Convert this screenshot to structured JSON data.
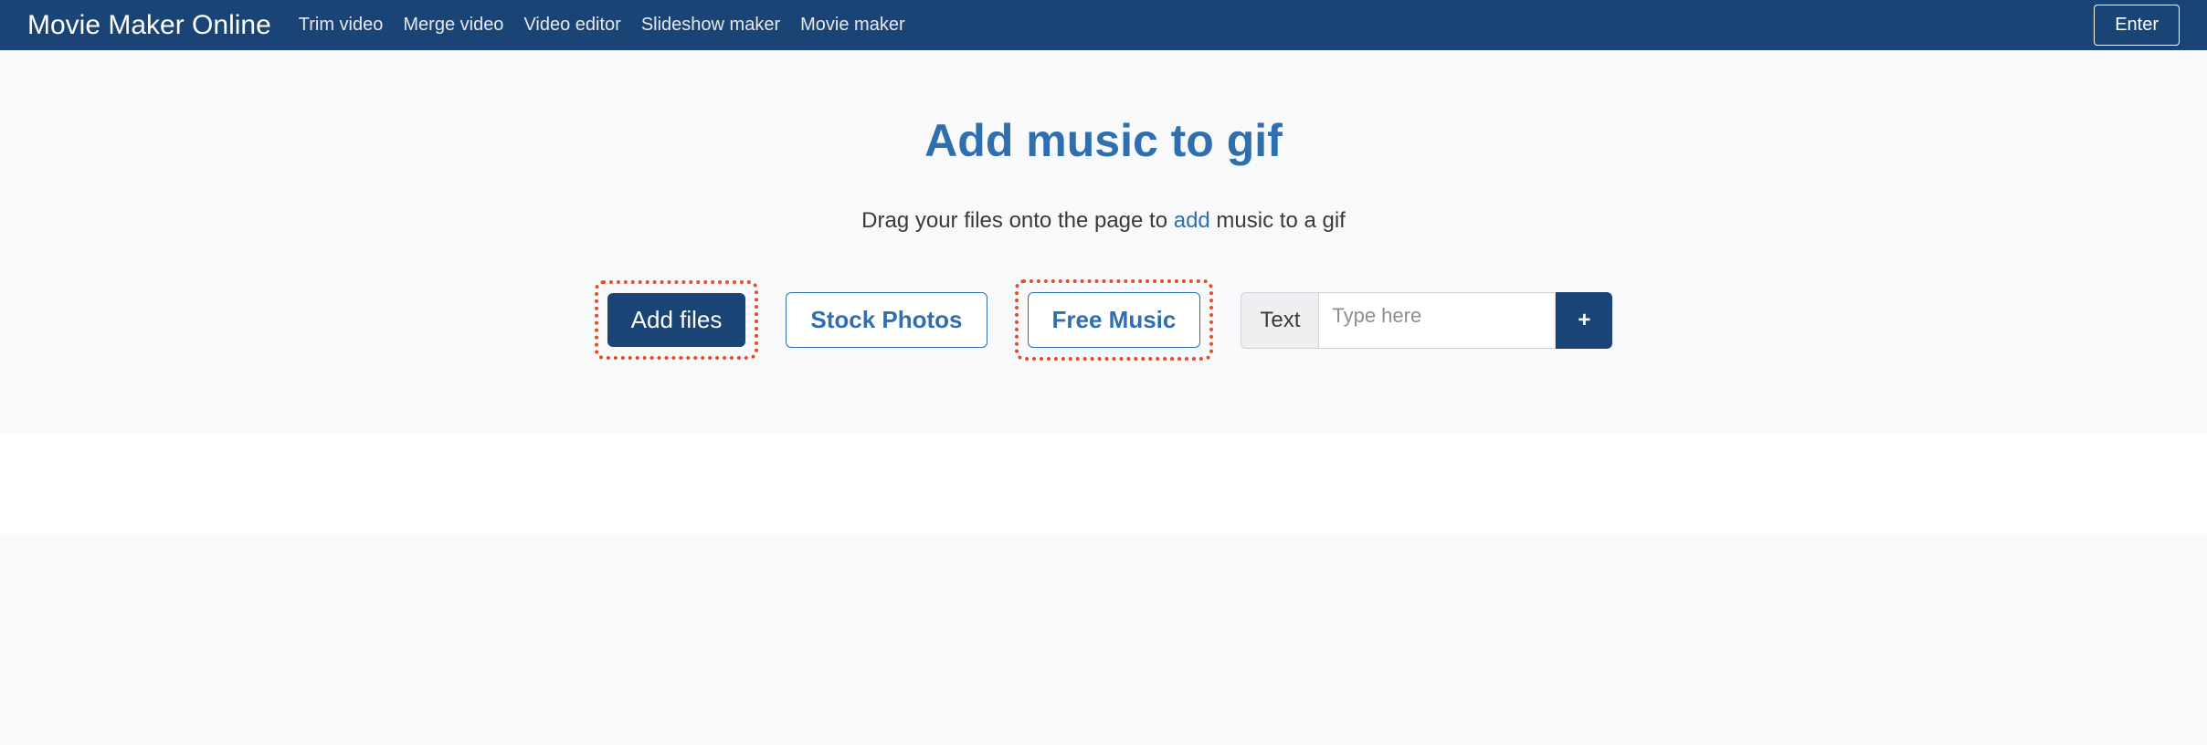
{
  "navbar": {
    "brand": "Movie Maker Online",
    "links": [
      "Trim video",
      "Merge video",
      "Video editor",
      "Slideshow maker",
      "Movie maker"
    ],
    "enter": "Enter"
  },
  "hero": {
    "title": "Add music to gif",
    "subtitle_pre": "Drag your files onto the page to ",
    "subtitle_link": "add",
    "subtitle_post": " music to a gif"
  },
  "controls": {
    "add_files": "Add files",
    "stock_photos": "Stock Photos",
    "free_music": "Free Music",
    "text_label": "Text",
    "text_placeholder": "Type here",
    "plus": "+"
  }
}
